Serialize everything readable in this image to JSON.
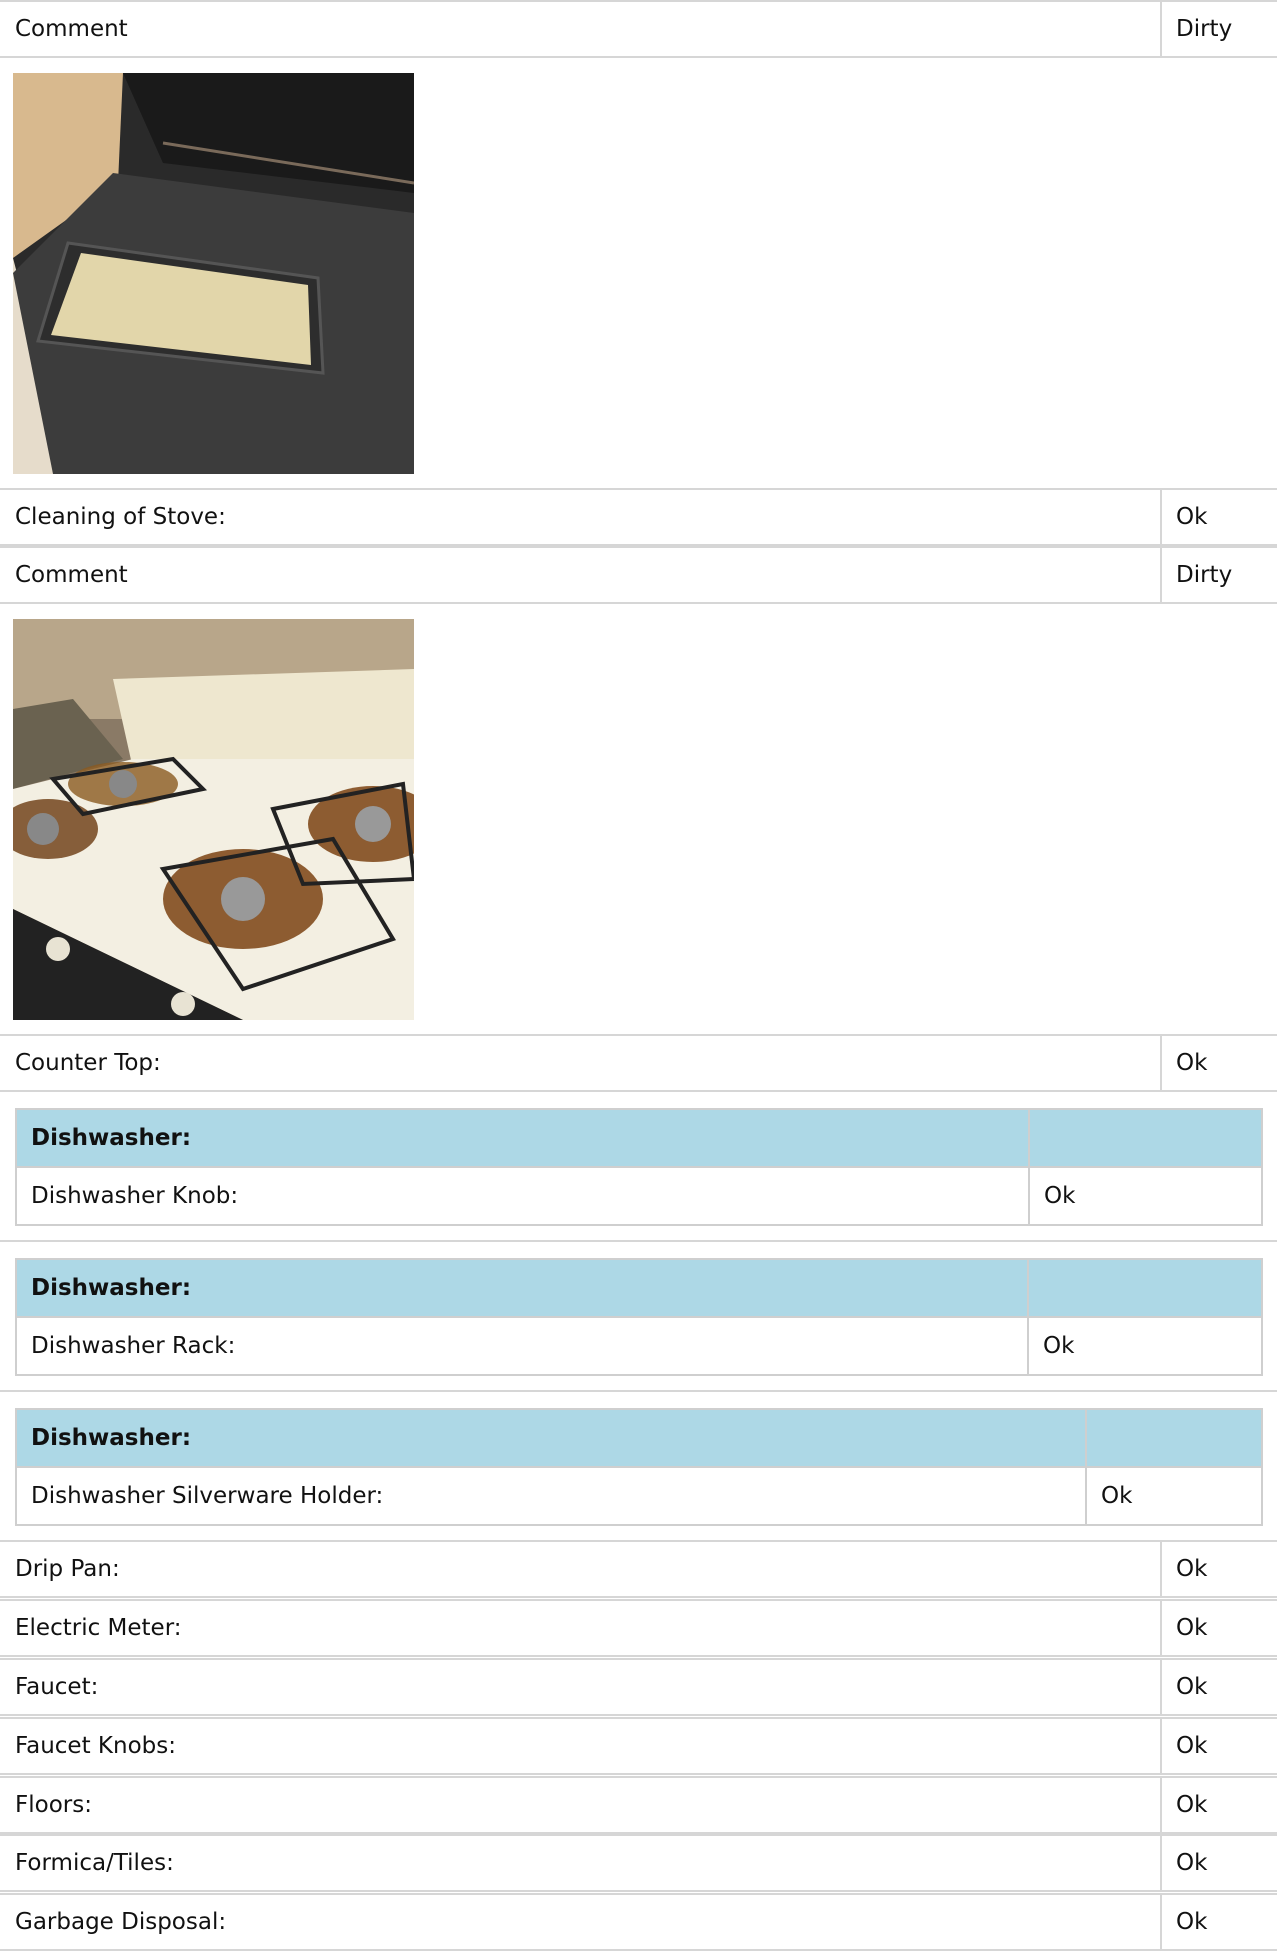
{
  "rows_top": [
    {
      "label": "Comment",
      "value": "Dirty"
    }
  ],
  "photos": {
    "oven": "oven-door-photo",
    "stove": "stove-top-photo"
  },
  "cleaning_stove": {
    "label": "Cleaning of Stove:",
    "value": "Ok"
  },
  "comment2": {
    "label": "Comment",
    "value": "Dirty"
  },
  "counter_top": {
    "label": "Counter Top:",
    "value": "Ok"
  },
  "dishwasher_sections": [
    {
      "header": "Dishwasher:",
      "label": "Dishwasher Knob:",
      "value": "Ok"
    },
    {
      "header": "Dishwasher:",
      "label": "Dishwasher Rack:",
      "value": "Ok"
    },
    {
      "header": "Dishwasher:",
      "label": "Dishwasher Silverware Holder:",
      "value": "Ok"
    }
  ],
  "items": [
    {
      "label": "Drip Pan:",
      "value": "Ok"
    },
    {
      "label": "Electric Meter:",
      "value": "Ok"
    },
    {
      "label": "Faucet:",
      "value": "Ok"
    },
    {
      "label": "Faucet Knobs:",
      "value": "Ok"
    },
    {
      "label": "Floors:",
      "value": "Ok"
    },
    {
      "label": "Formica/Tiles:",
      "value": "Ok"
    },
    {
      "label": "Garbage Disposal:",
      "value": "Ok"
    }
  ]
}
